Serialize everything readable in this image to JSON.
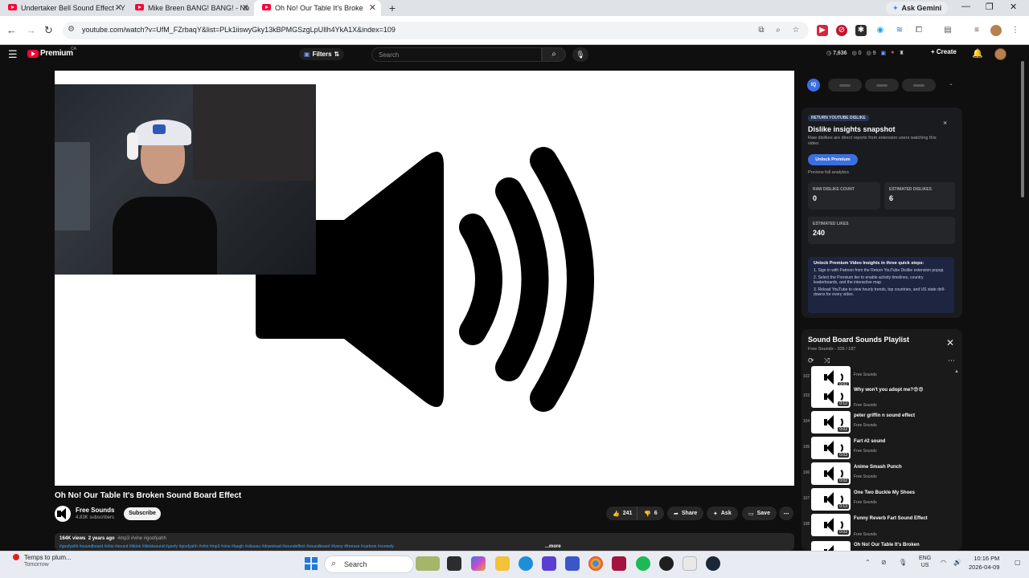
{
  "browser": {
    "tabs": [
      {
        "title": "Undertaker Bell Sound Effect - Y",
        "active": false
      },
      {
        "title": "Mike Breen BANG! BANG! - Nb",
        "active": false
      },
      {
        "title": "Oh No! Our Table It's Broke",
        "active": true
      }
    ],
    "new_tab": "+",
    "gemini_label": "Ask Gemini",
    "url": "youtube.com/watch?v=UfM_FZrbaqY&list=PLk1iiswyGky13kBPMGSzgLpUIlh4YkA1X&index=109",
    "window_controls": {
      "minimize": "—",
      "restore": "❐",
      "close": "✕"
    }
  },
  "youtube_header": {
    "logo_text": "Premium",
    "region": "CA",
    "filters_label": "Filters",
    "search_placeholder": "Search",
    "stats": [
      "7,636",
      "0",
      "9"
    ],
    "create_label": "Create"
  },
  "video": {
    "title": "Oh No! Our Table It's Broken Sound Board Effect",
    "channel": "Free Sounds",
    "subscribers": "4.83K subscribers",
    "subscribe_label": "Subscribe",
    "likes": "241",
    "dislikes": "6",
    "share_label": "Share",
    "ask_label": "Ask",
    "save_label": "Save",
    "views": "164K views",
    "age": "2 years ago",
    "hashtags": "#mp3 #vine #goofyahh",
    "tags_line": "#goofyahh #soundboard #ohio #sound #tiktok #tiktoksound #goofy #goofyahh #ohio #mp3 #vine #laugh #viiiuuuu #download #soundeffect #soundboard #funny #freeuse #cartoon #comedy",
    "more_label": "...more"
  },
  "ryd_panel": {
    "tag": "RETURN YOUTUBE DISLIKE",
    "heading": "Dislike insights snapshot",
    "subtitle": "Raw dislikes are direct reports from extension users watching this video.",
    "unlock_label": "Unlock Premium",
    "preview_label": "Preview full analytics",
    "raw_dislike_label": "RAW DISLIKE COUNT",
    "raw_dislike_value": "0",
    "est_dislike_label": "ESTIMATED DISLIKES",
    "est_dislike_value": "6",
    "est_likes_label": "ESTIMATED LIKES",
    "est_likes_value": "240",
    "steps_heading": "Unlock Premium Video Insights in three quick steps:",
    "steps": [
      "1.  Sign in with Patreon from the Return YouTube Dislike extension popup.",
      "2.  Select the Premium tier to enable activity timelines, country leaderboards, and the interactive map.",
      "3.  Reload YouTube to view hourly trends, top countries, and US state drill-downs for every video."
    ]
  },
  "playlist": {
    "title": "Sound Board Sounds Playlist",
    "subtitle": "Free Sounds - 109 / 187",
    "items": [
      {
        "num": "102",
        "title": "",
        "channel": "Free Sounds",
        "duration": "0:02"
      },
      {
        "num": "103",
        "title": "Why won't you adopt me?😨😨",
        "channel": "Free Sounds",
        "duration": "0:12"
      },
      {
        "num": "104",
        "title": "peter griffin n sound effect",
        "channel": "Free Sounds",
        "duration": "0:02"
      },
      {
        "num": "105",
        "title": "Fart #2 sound",
        "channel": "Free Sounds",
        "duration": "0:03"
      },
      {
        "num": "106",
        "title": "Anime Smash Punch",
        "channel": "Free Sounds",
        "duration": "0:02"
      },
      {
        "num": "107",
        "title": "One Two Buckle My Shoes",
        "channel": "Free Sounds",
        "duration": "0:13"
      },
      {
        "num": "108",
        "title": "Funny Reverb Fart Sound Effect",
        "channel": "Free Sounds",
        "duration": "0:02"
      },
      {
        "num": "",
        "title": "Oh No! Our Table It's Broken",
        "channel": "",
        "duration": ""
      }
    ]
  },
  "taskbar": {
    "weather_title": "Temps to plum...",
    "weather_sub": "Tomorrow",
    "search_label": "Search",
    "lang_top": "ENG",
    "lang_bottom": "US",
    "time": "10:16 PM",
    "date": "2026-04-09"
  },
  "colors": {
    "youtube_red": "#ff0033",
    "ryd_accent": "#3b6fe0",
    "link_blue": "#3ea6ff",
    "page_bg": "#0f0f0f"
  }
}
